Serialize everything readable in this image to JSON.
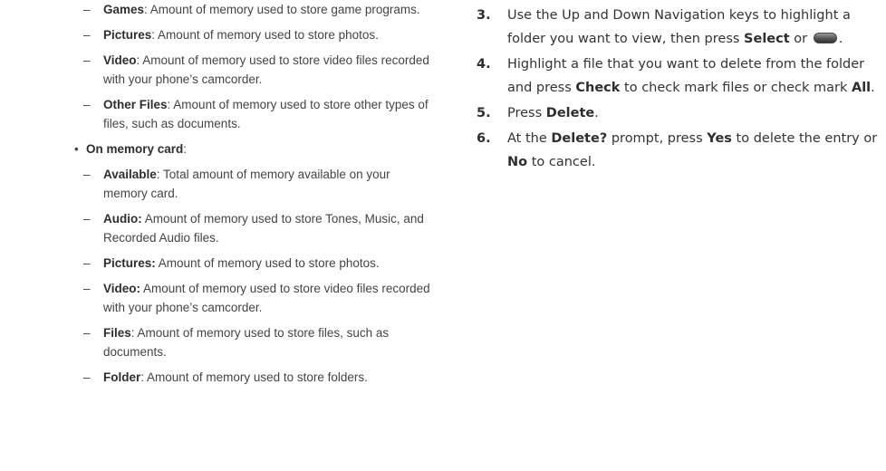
{
  "left": {
    "phone_items": [
      {
        "term": "Games",
        "sep": ":",
        "desc": " Amount of memory used to store game programs."
      },
      {
        "term": "Pictures",
        "sep": ":",
        "desc": " Amount of memory used to store photos."
      },
      {
        "term": "Video",
        "sep": ":",
        "desc": " Amount of memory used to store video files recorded with your phone’s camcorder."
      },
      {
        "term": "Other Files",
        "sep": ":",
        "desc": " Amount of memory used to store other types of files, such as documents."
      }
    ],
    "card_heading": {
      "bullet": "•",
      "term": "On memory card",
      "sep": ":"
    },
    "card_items": [
      {
        "term": "Available",
        "sep": ":",
        "desc": " Total amount of memory available on your memory card."
      },
      {
        "term": "Audio:",
        "sep": "",
        "desc": " Amount of memory used to store Tones, Music, and Recorded Audio files."
      },
      {
        "term": "Pictures:",
        "sep": "",
        "desc": " Amount of memory used to store photos."
      },
      {
        "term": "Video:",
        "sep": "",
        "desc": " Amount of memory used to store video files recorded with your phone’s camcorder."
      },
      {
        "term": "Files",
        "sep": ":",
        "desc": " Amount of memory used to store files, such as documents."
      },
      {
        "term": "Folder",
        "sep": ":",
        "desc": " Amount of memory used to store folders."
      }
    ],
    "dash": "–"
  },
  "right": {
    "step3": {
      "num": "3.",
      "a": "Use the Up and Down Navigation keys to highlight a folder you want to view, then press ",
      "b1": "Select",
      "c": " or ",
      "d": "."
    },
    "step4": {
      "num": "4.",
      "a": "Highlight a file that you want to delete from the folder and press ",
      "b1": "Check",
      "c": " to check mark files or check mark ",
      "b2": "All",
      "d": "."
    },
    "step5": {
      "num": "5.",
      "a": "Press ",
      "b1": "Delete",
      "d": "."
    },
    "step6": {
      "num": "6.",
      "a": "At the ",
      "b1": "Delete?",
      "c": " prompt, press ",
      "b2": "Yes",
      "e": " to delete the entry or ",
      "b3": "No",
      "f": " to cancel."
    }
  },
  "icons": {
    "key": "select-key-icon"
  }
}
